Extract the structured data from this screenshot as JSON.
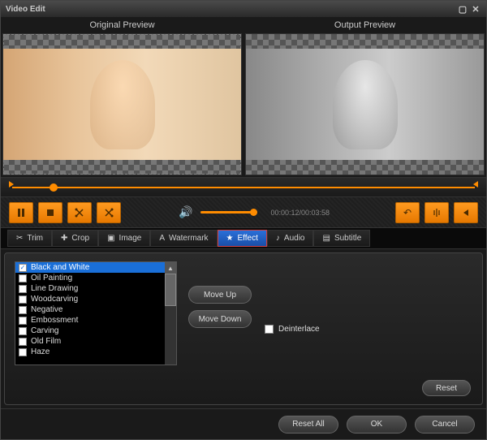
{
  "window": {
    "title": "Video Edit"
  },
  "preview": {
    "original_label": "Original Preview",
    "output_label": "Output Preview"
  },
  "playback": {
    "time": "00:00:12/00:03:58"
  },
  "tabs": [
    {
      "label": "Trim"
    },
    {
      "label": "Crop"
    },
    {
      "label": "Image"
    },
    {
      "label": "Watermark"
    },
    {
      "label": "Effect"
    },
    {
      "label": "Audio"
    },
    {
      "label": "Subtitle"
    }
  ],
  "effects": {
    "items": [
      {
        "label": "Black and White",
        "checked": true,
        "selected": true
      },
      {
        "label": "Oil Painting",
        "checked": false,
        "selected": false
      },
      {
        "label": "Line Drawing",
        "checked": false,
        "selected": false
      },
      {
        "label": "Woodcarving",
        "checked": false,
        "selected": false
      },
      {
        "label": "Negative",
        "checked": false,
        "selected": false
      },
      {
        "label": "Embossment",
        "checked": false,
        "selected": false
      },
      {
        "label": "Carving",
        "checked": false,
        "selected": false
      },
      {
        "label": "Old Film",
        "checked": false,
        "selected": false
      },
      {
        "label": "Haze",
        "checked": false,
        "selected": false
      }
    ],
    "move_up": "Move Up",
    "move_down": "Move Down",
    "deinterlace": "Deinterlace",
    "reset": "Reset"
  },
  "footer": {
    "reset_all": "Reset All",
    "ok": "OK",
    "cancel": "Cancel"
  }
}
